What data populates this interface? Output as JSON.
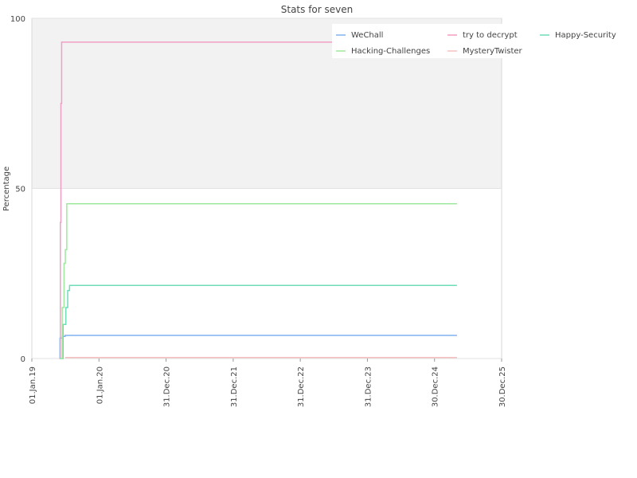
{
  "chart_data": {
    "type": "line",
    "title": "Stats for seven",
    "xlabel": "",
    "ylabel": "Percentage",
    "ylim": [
      0,
      100
    ],
    "yticks": [
      0,
      50,
      100
    ],
    "xlim": [
      "2019-01-01",
      "2025-12-30"
    ],
    "xticks": [
      {
        "date": "2019-01-01",
        "label": "01.Jan.19"
      },
      {
        "date": "2020-01-01",
        "label": "01.Jan.20"
      },
      {
        "date": "2020-12-31",
        "label": "31.Dec.20"
      },
      {
        "date": "2021-12-31",
        "label": "31.Dec.21"
      },
      {
        "date": "2022-12-31",
        "label": "31.Dec.22"
      },
      {
        "date": "2023-12-31",
        "label": "31.Dec.23"
      },
      {
        "date": "2024-12-30",
        "label": "30.Dec.24"
      },
      {
        "date": "2025-12-30",
        "label": "30.Dec.25"
      }
    ],
    "shaded_band": [
      50,
      100
    ],
    "legend_position": "top-right",
    "series": [
      {
        "name": "WeChall",
        "color": "#7fb2f0",
        "points": [
          [
            "2019-06-01",
            0
          ],
          [
            "2019-06-03",
            6
          ],
          [
            "2019-06-15",
            6.5
          ],
          [
            "2019-07-01",
            6.8
          ],
          [
            "2025-05-01",
            6.8
          ]
        ]
      },
      {
        "name": "try to decrypt",
        "color": "#f29ec2",
        "points": [
          [
            "2019-06-01",
            0
          ],
          [
            "2019-06-05",
            40
          ],
          [
            "2019-06-08",
            75
          ],
          [
            "2019-06-12",
            93
          ],
          [
            "2025-05-01",
            93
          ]
        ]
      },
      {
        "name": "Happy-Security",
        "color": "#6fdcb8",
        "points": [
          [
            "2019-06-05",
            0
          ],
          [
            "2019-06-20",
            10
          ],
          [
            "2019-07-05",
            15
          ],
          [
            "2019-07-15",
            20
          ],
          [
            "2019-07-25",
            21.5
          ],
          [
            "2025-05-01",
            21.5
          ]
        ]
      },
      {
        "name": "Hacking-Challenges",
        "color": "#9ee89e",
        "points": [
          [
            "2019-06-05",
            0
          ],
          [
            "2019-06-15",
            15
          ],
          [
            "2019-06-25",
            28
          ],
          [
            "2019-07-02",
            32
          ],
          [
            "2019-07-10",
            45.5
          ],
          [
            "2025-05-01",
            45.5
          ]
        ]
      },
      {
        "name": "MysteryTwister",
        "color": "#f7c0c0",
        "points": [
          [
            "2019-07-01",
            0.3
          ],
          [
            "2025-05-01",
            0.3
          ]
        ]
      }
    ]
  }
}
